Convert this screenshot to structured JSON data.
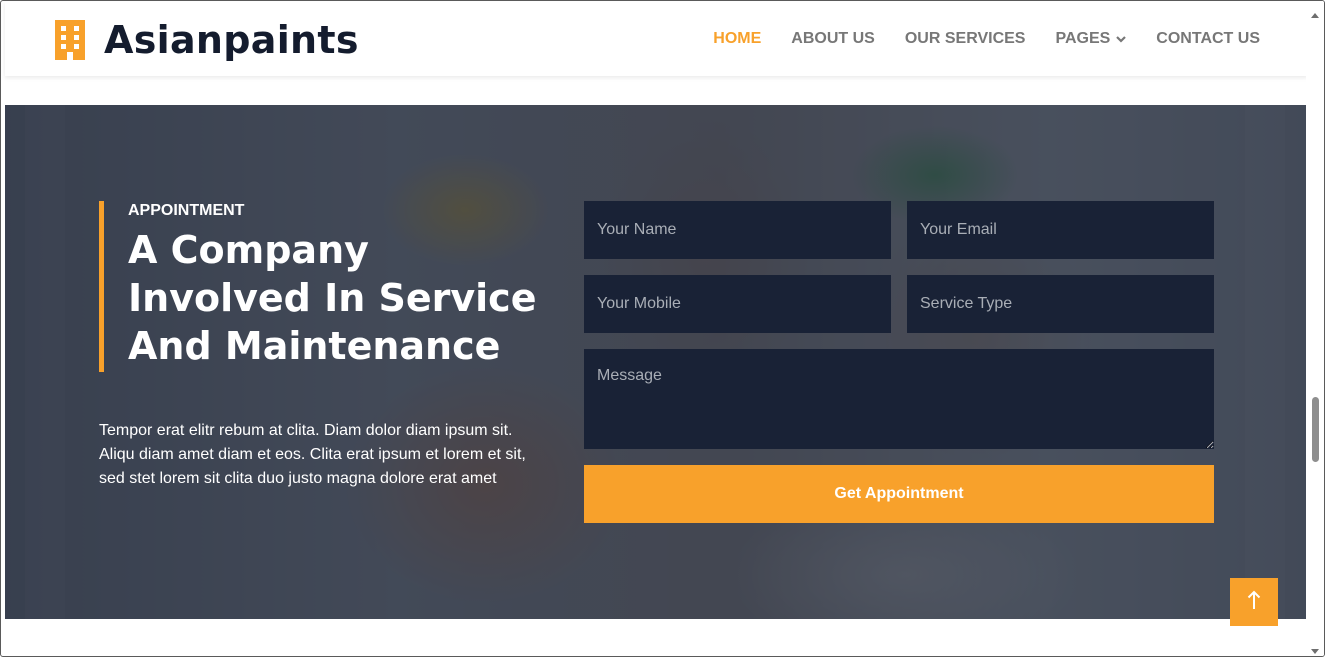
{
  "brand": {
    "name": "Asianpaints",
    "icon": "building-icon"
  },
  "nav": {
    "items": [
      {
        "label": "HOME",
        "active": true
      },
      {
        "label": "ABOUT US",
        "active": false
      },
      {
        "label": "OUR SERVICES",
        "active": false
      },
      {
        "label": "PAGES",
        "active": false,
        "dropdown": true
      },
      {
        "label": "CONTACT US",
        "active": false
      }
    ]
  },
  "hero": {
    "subtitle": "APPOINTMENT",
    "headline": "A Company Involved In Service And Maintenance",
    "lead": "Tempor erat elitr rebum at clita. Diam dolor diam ipsum sit. Aliqu diam amet diam et eos. Clita erat ipsum et lorem et sit, sed stet lorem sit clita duo justo magna dolore erat amet"
  },
  "form": {
    "name_placeholder": "Your Name",
    "email_placeholder": "Your Email",
    "mobile_placeholder": "Your Mobile",
    "service_placeholder": "Service Type",
    "message_placeholder": "Message",
    "submit_label": "Get Appointment"
  },
  "colors": {
    "accent": "#f8a12b",
    "dark": "#141c2e",
    "field_bg": "#192236",
    "nav_text": "#777777"
  },
  "back_to_top": {
    "icon": "arrow-up-icon"
  }
}
